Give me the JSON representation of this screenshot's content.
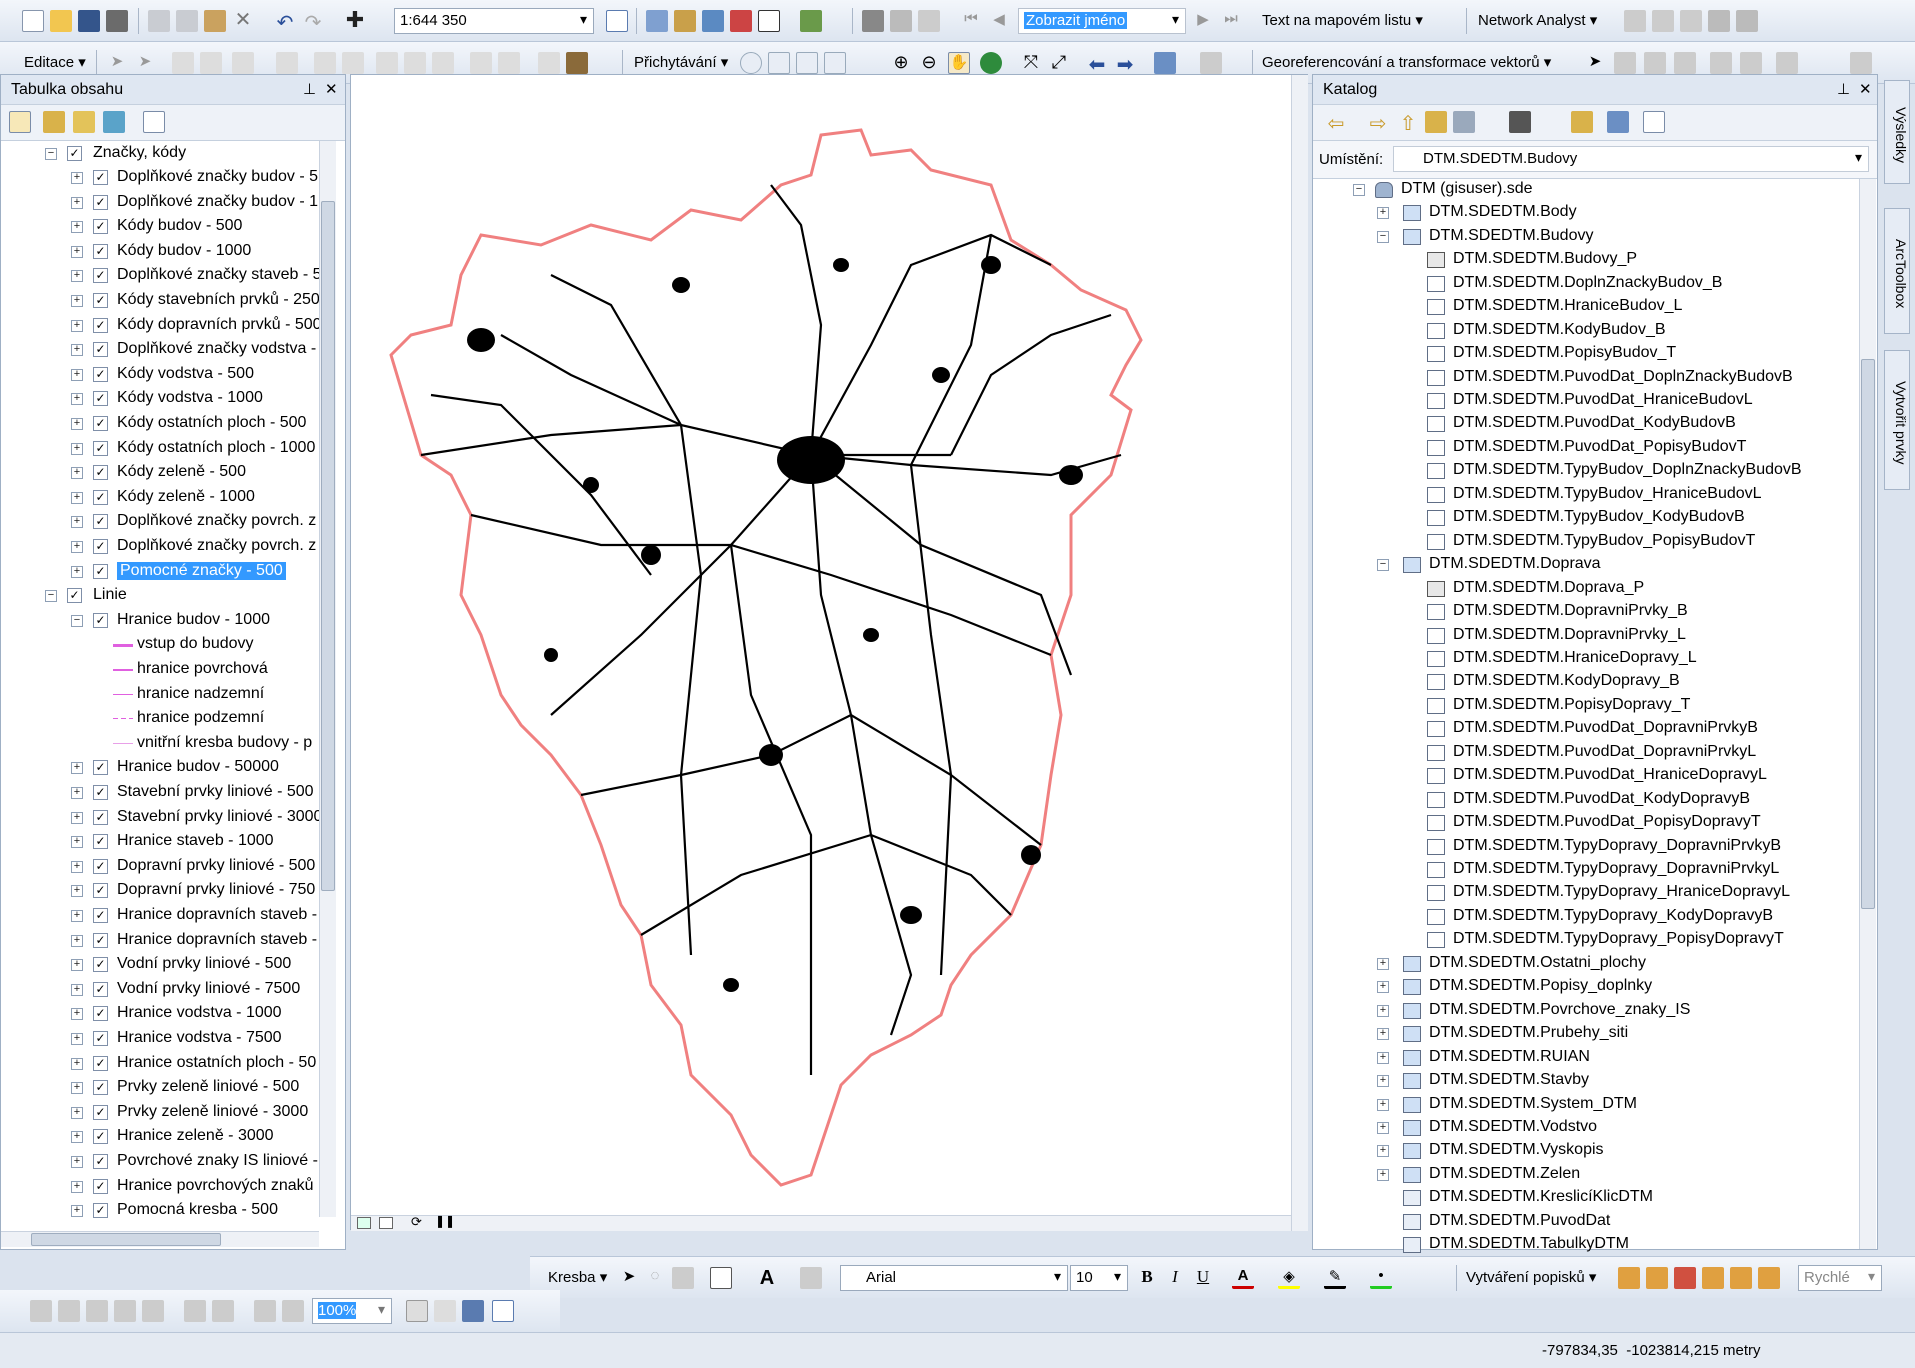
{
  "toolbar_row1": {
    "scale": "1:644 350",
    "find_field": "Zobrazit jméno",
    "text_label": "Text na mapovém listu",
    "network_analyst": "Network Analyst"
  },
  "toolbar_row2": {
    "editor": "Editace",
    "snapping": "Přichytávání",
    "georef": "Georeferencování a transformace vektorů"
  },
  "toc": {
    "title": "Tabulka obsahu",
    "group1": "Značky, kódy",
    "group1_items": [
      "Doplňkové značky budov - 5",
      "Doplňkové značky budov - 1",
      "Kódy budov - 500",
      "Kódy budov - 1000",
      "Doplňkové značky staveb - 5",
      "Kódy stavebních prvků - 250",
      "Kódy dopravních prvků - 500",
      "Doplňkové značky vodstva -",
      "Kódy vodstva - 500",
      "Kódy vodstva - 1000",
      "Kódy ostatních ploch - 500",
      "Kódy ostatních ploch - 1000",
      "Kódy zeleně - 500",
      "Kódy zeleně - 1000",
      "Doplňkové značky povrch. z",
      "Doplňkové značky povrch. z",
      "Pomocné značky - 500"
    ],
    "group2": "Linie",
    "sublayer": "Hranice budov - 1000",
    "legend": [
      "vstup do budovy",
      "hranice povrchová",
      "hranice nadzemní",
      "hranice podzemní",
      "vnitřní kresba budovy - p"
    ],
    "group2_items": [
      "Hranice budov - 50000",
      "Stavební prvky liniové - 500",
      "Stavební prvky liniové - 3000",
      "Hranice staveb - 1000",
      "Dopravní prvky liniové - 500",
      "Dopravní prvky liniové - 750",
      "Hranice dopravních staveb -",
      "Hranice dopravních staveb -",
      "Vodní prvky liniové - 500",
      "Vodní prvky liniové - 7500",
      "Hranice vodstva - 1000",
      "Hranice vodstva - 7500",
      "Hranice ostatních ploch - 50",
      "Prvky zeleně liniové - 500",
      "Prvky zeleně liniové - 3000",
      "Hranice zeleně - 3000",
      "Povrchové znaky IS liniové -",
      "Hranice povrchových znaků",
      "Pomocná kresba - 500"
    ]
  },
  "catalog": {
    "title": "Katalog",
    "location_label": "Umístění:",
    "location_value": "DTM.SDEDTM.Budovy",
    "root": "DTM (gisuser).sde",
    "items": [
      {
        "t": "DTM.SDEDTM.Body",
        "lvl": 1,
        "exp": "+",
        "icon": "fd"
      },
      {
        "t": "DTM.SDEDTM.Budovy",
        "lvl": 1,
        "exp": "-",
        "icon": "fd"
      },
      {
        "t": "DTM.SDEDTM.Budovy_P",
        "lvl": 2,
        "icon": "poly"
      },
      {
        "t": "DTM.SDEDTM.DoplnZnackyBudov_B",
        "lvl": 2,
        "icon": "pt"
      },
      {
        "t": "DTM.SDEDTM.HraniceBudov_L",
        "lvl": 2,
        "icon": "ln"
      },
      {
        "t": "DTM.SDEDTM.KodyBudov_B",
        "lvl": 2,
        "icon": "pt"
      },
      {
        "t": "DTM.SDEDTM.PopisyBudov_T",
        "lvl": 2,
        "icon": "pt"
      },
      {
        "t": "DTM.SDEDTM.PuvodDat_DoplnZnackyBudovB",
        "lvl": 2,
        "icon": "rel"
      },
      {
        "t": "DTM.SDEDTM.PuvodDat_HraniceBudovL",
        "lvl": 2,
        "icon": "rel"
      },
      {
        "t": "DTM.SDEDTM.PuvodDat_KodyBudovB",
        "lvl": 2,
        "icon": "rel"
      },
      {
        "t": "DTM.SDEDTM.PuvodDat_PopisyBudovT",
        "lvl": 2,
        "icon": "rel"
      },
      {
        "t": "DTM.SDEDTM.TypyBudov_DoplnZnackyBudovB",
        "lvl": 2,
        "icon": "rel"
      },
      {
        "t": "DTM.SDEDTM.TypyBudov_HraniceBudovL",
        "lvl": 2,
        "icon": "rel"
      },
      {
        "t": "DTM.SDEDTM.TypyBudov_KodyBudovB",
        "lvl": 2,
        "icon": "rel"
      },
      {
        "t": "DTM.SDEDTM.TypyBudov_PopisyBudovT",
        "lvl": 2,
        "icon": "rel"
      },
      {
        "t": "DTM.SDEDTM.Doprava",
        "lvl": 1,
        "exp": "-",
        "icon": "fd"
      },
      {
        "t": "DTM.SDEDTM.Doprava_P",
        "lvl": 2,
        "icon": "poly"
      },
      {
        "t": "DTM.SDEDTM.DopravniPrvky_B",
        "lvl": 2,
        "icon": "pt"
      },
      {
        "t": "DTM.SDEDTM.DopravniPrvky_L",
        "lvl": 2,
        "icon": "ln"
      },
      {
        "t": "DTM.SDEDTM.HraniceDopravy_L",
        "lvl": 2,
        "icon": "ln"
      },
      {
        "t": "DTM.SDEDTM.KodyDopravy_B",
        "lvl": 2,
        "icon": "pt"
      },
      {
        "t": "DTM.SDEDTM.PopisyDopravy_T",
        "lvl": 2,
        "icon": "pt"
      },
      {
        "t": "DTM.SDEDTM.PuvodDat_DopravniPrvkyB",
        "lvl": 2,
        "icon": "rel"
      },
      {
        "t": "DTM.SDEDTM.PuvodDat_DopravniPrvkyL",
        "lvl": 2,
        "icon": "rel"
      },
      {
        "t": "DTM.SDEDTM.PuvodDat_HraniceDopravyL",
        "lvl": 2,
        "icon": "rel"
      },
      {
        "t": "DTM.SDEDTM.PuvodDat_KodyDopravyB",
        "lvl": 2,
        "icon": "rel"
      },
      {
        "t": "DTM.SDEDTM.PuvodDat_PopisyDopravyT",
        "lvl": 2,
        "icon": "rel"
      },
      {
        "t": "DTM.SDEDTM.TypyDopravy_DopravniPrvkyB",
        "lvl": 2,
        "icon": "rel"
      },
      {
        "t": "DTM.SDEDTM.TypyDopravy_DopravniPrvkyL",
        "lvl": 2,
        "icon": "rel"
      },
      {
        "t": "DTM.SDEDTM.TypyDopravy_HraniceDopravyL",
        "lvl": 2,
        "icon": "rel"
      },
      {
        "t": "DTM.SDEDTM.TypyDopravy_KodyDopravyB",
        "lvl": 2,
        "icon": "rel"
      },
      {
        "t": "DTM.SDEDTM.TypyDopravy_PopisyDopravyT",
        "lvl": 2,
        "icon": "rel"
      },
      {
        "t": "DTM.SDEDTM.Ostatni_plochy",
        "lvl": 1,
        "exp": "+",
        "icon": "fd"
      },
      {
        "t": "DTM.SDEDTM.Popisy_doplnky",
        "lvl": 1,
        "exp": "+",
        "icon": "fd"
      },
      {
        "t": "DTM.SDEDTM.Povrchove_znaky_IS",
        "lvl": 1,
        "exp": "+",
        "icon": "fd"
      },
      {
        "t": "DTM.SDEDTM.Prubehy_siti",
        "lvl": 1,
        "exp": "+",
        "icon": "fd"
      },
      {
        "t": "DTM.SDEDTM.RUIAN",
        "lvl": 1,
        "exp": "+",
        "icon": "fd"
      },
      {
        "t": "DTM.SDEDTM.Stavby",
        "lvl": 1,
        "exp": "+",
        "icon": "fd"
      },
      {
        "t": "DTM.SDEDTM.System_DTM",
        "lvl": 1,
        "exp": "+",
        "icon": "fd"
      },
      {
        "t": "DTM.SDEDTM.Vodstvo",
        "lvl": 1,
        "exp": "+",
        "icon": "fd"
      },
      {
        "t": "DTM.SDEDTM.Vyskopis",
        "lvl": 1,
        "exp": "+",
        "icon": "fd"
      },
      {
        "t": "DTM.SDEDTM.Zelen",
        "lvl": 1,
        "exp": "+",
        "icon": "fd"
      },
      {
        "t": "DTM.SDEDTM.KreslicíKlicDTM",
        "lvl": 1,
        "icon": "tbl"
      },
      {
        "t": "DTM.SDEDTM.PuvodDat",
        "lvl": 1,
        "icon": "tbl"
      },
      {
        "t": "DTM.SDEDTM.TabulkyDTM",
        "lvl": 1,
        "icon": "tbl"
      }
    ]
  },
  "side_tabs": [
    "Výsledky",
    "ArcToolbox",
    "Vytvořit prvky"
  ],
  "draw_toolbar": {
    "draw": "Kresba",
    "font": "Arial",
    "size": "10",
    "bold": "B",
    "italic": "I",
    "underline": "U",
    "labeling": "Vytváření popisků",
    "quick": "Rychlé"
  },
  "bottom_toolbar": {
    "zoom": "100%"
  },
  "status": {
    "coords": "-797834,35  -1023814,215 metry"
  },
  "colors": {
    "boundary": "#f08080",
    "selection": "#3399ff"
  }
}
